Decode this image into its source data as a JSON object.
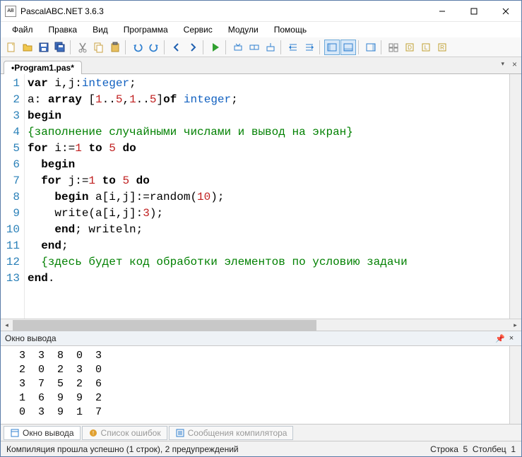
{
  "window": {
    "title": "PascalABC.NET 3.6.3"
  },
  "menu": [
    "Файл",
    "Правка",
    "Вид",
    "Программа",
    "Сервис",
    "Модули",
    "Помощь"
  ],
  "tab": {
    "name": "•Program1.pas*"
  },
  "code": {
    "lines": [
      {
        "n": "1",
        "tokens": [
          {
            "t": "var",
            "c": "kw"
          },
          {
            "t": " i,j:"
          },
          {
            "t": "integer",
            "c": "ty"
          },
          {
            "t": ";"
          }
        ]
      },
      {
        "n": "2",
        "tokens": [
          {
            "t": "a: "
          },
          {
            "t": "array",
            "c": "kw"
          },
          {
            "t": " ["
          },
          {
            "t": "1",
            "c": "num"
          },
          {
            "t": ".."
          },
          {
            "t": "5",
            "c": "num"
          },
          {
            "t": ","
          },
          {
            "t": "1",
            "c": "num"
          },
          {
            "t": ".."
          },
          {
            "t": "5",
            "c": "num"
          },
          {
            "t": "]"
          },
          {
            "t": "of",
            "c": "kw"
          },
          {
            "t": " "
          },
          {
            "t": "integer",
            "c": "ty"
          },
          {
            "t": ";"
          }
        ]
      },
      {
        "n": "3",
        "tokens": [
          {
            "t": "begin",
            "c": "kw"
          }
        ]
      },
      {
        "n": "4",
        "tokens": [
          {
            "t": "{заполнение случайными числами и вывод на экран}",
            "c": "cm"
          }
        ]
      },
      {
        "n": "5",
        "tokens": [
          {
            "t": "for",
            "c": "kw"
          },
          {
            "t": " i:="
          },
          {
            "t": "1",
            "c": "num"
          },
          {
            "t": " "
          },
          {
            "t": "to",
            "c": "kw"
          },
          {
            "t": " "
          },
          {
            "t": "5",
            "c": "num"
          },
          {
            "t": " "
          },
          {
            "t": "do",
            "c": "kw"
          }
        ]
      },
      {
        "n": "6",
        "tokens": [
          {
            "t": "  "
          },
          {
            "t": "begin",
            "c": "kw"
          }
        ]
      },
      {
        "n": "7",
        "tokens": [
          {
            "t": "  "
          },
          {
            "t": "for",
            "c": "kw"
          },
          {
            "t": " j:="
          },
          {
            "t": "1",
            "c": "num"
          },
          {
            "t": " "
          },
          {
            "t": "to",
            "c": "kw"
          },
          {
            "t": " "
          },
          {
            "t": "5",
            "c": "num"
          },
          {
            "t": " "
          },
          {
            "t": "do",
            "c": "kw"
          }
        ]
      },
      {
        "n": "8",
        "tokens": [
          {
            "t": "    "
          },
          {
            "t": "begin",
            "c": "kw"
          },
          {
            "t": " a[i,j]:=random("
          },
          {
            "t": "10",
            "c": "num"
          },
          {
            "t": ");"
          }
        ]
      },
      {
        "n": "9",
        "tokens": [
          {
            "t": "    write(a[i,j]:"
          },
          {
            "t": "3",
            "c": "num"
          },
          {
            "t": ");"
          }
        ]
      },
      {
        "n": "10",
        "tokens": [
          {
            "t": "    "
          },
          {
            "t": "end",
            "c": "kw"
          },
          {
            "t": "; writeln;"
          }
        ]
      },
      {
        "n": "11",
        "tokens": [
          {
            "t": "  "
          },
          {
            "t": "end",
            "c": "kw"
          },
          {
            "t": ";"
          }
        ]
      },
      {
        "n": "12",
        "tokens": [
          {
            "t": "  "
          },
          {
            "t": "{здесь будет код обработки элементов по условию задачи",
            "c": "cm"
          }
        ]
      },
      {
        "n": "13",
        "tokens": [
          {
            "t": "end",
            "c": "kw"
          },
          {
            "t": "."
          }
        ]
      }
    ]
  },
  "output_panel": {
    "title": "Окно вывода",
    "text": "  3  3  8  0  3\n  2  0  2  3  0\n  3  7  5  2  6\n  1  6  9  9  2\n  0  3  9  1  7"
  },
  "bottom_tabs": {
    "output": "Окно вывода",
    "errors": "Список ошибок",
    "compiler": "Сообщения компилятора"
  },
  "status": {
    "left": "Компиляция прошла успешно (1 строк), 2 предупреждений",
    "line_label": "Строка",
    "line_val": "5",
    "col_label": "Столбец",
    "col_val": "1"
  }
}
